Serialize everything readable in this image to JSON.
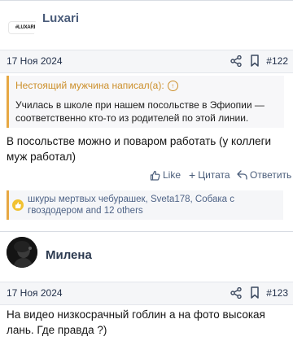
{
  "posts": [
    {
      "author": "Luxari",
      "avatar_text": "#LUXARI",
      "date": "17 Ноя 2024",
      "number": "#122",
      "quote": {
        "author_line": "Нестоящий мужчина написал(а):",
        "text": "Училась в школе при нашем посольстве в Эфиопии — соответственно кто-то из родителей по этой линии."
      },
      "text": "В посольстве можно и поваром работать (у коллеги муж работал)",
      "actions": {
        "like": "Like",
        "quote": "Цитата",
        "reply": "Ответить"
      },
      "reactions": "шкуры мертвых чебурашек, Sveta178, Собака с гвоздодером and 12 others"
    },
    {
      "author": "Милена",
      "date": "17 Ноя 2024",
      "number": "#123",
      "text": "На видео низкосрачный гоблин а на фото высокая лань. Где правда ?)"
    }
  ],
  "colors": {
    "accent": "#e7a843",
    "link": "#4a5d7a"
  },
  "icons": [
    "share-icon",
    "bookmark-icon",
    "like-icon",
    "plus-icon",
    "reply-icon",
    "thumbs-up-icon",
    "up-arrow-icon"
  ]
}
